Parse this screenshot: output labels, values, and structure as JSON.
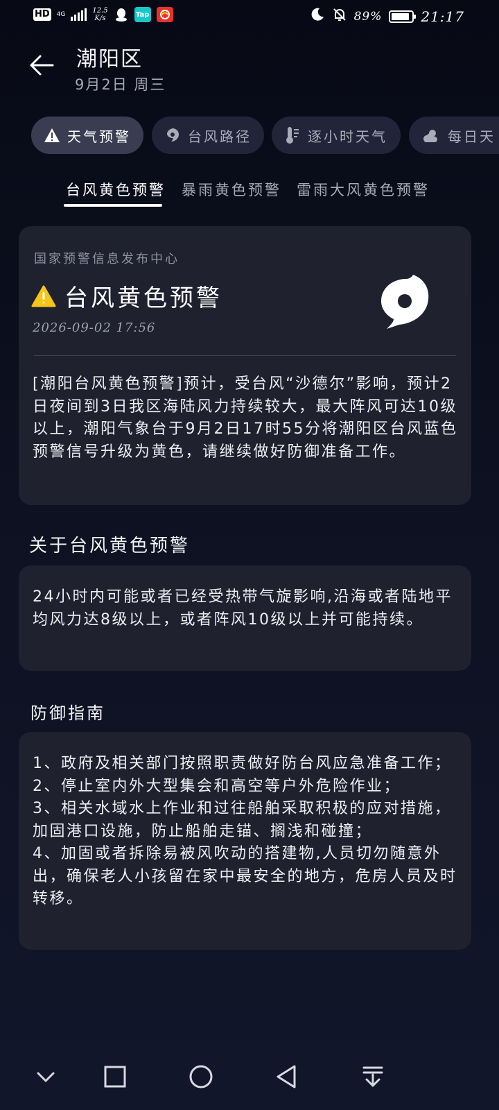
{
  "status_bar": {
    "hd": "HD",
    "network": "4G",
    "speed": "12.5",
    "speed_unit": "K/s",
    "battery": "89%",
    "battery_level": 0.89,
    "time": "21:17",
    "app_icons": [
      "qq-icon",
      "taptap-icon",
      "china-mobile-icon"
    ],
    "tap_label": "Tap",
    "status_icons": [
      "moon-icon",
      "bell-off-icon"
    ]
  },
  "header": {
    "title": "潮阳区",
    "subtitle": "9月2日 周三"
  },
  "chips": [
    {
      "label": "天气预警",
      "icon": "warning-icon",
      "active": true
    },
    {
      "label": "台风路径",
      "icon": "typhoon-icon",
      "active": false
    },
    {
      "label": "逐小时天气",
      "icon": "thermometer-icon",
      "active": false
    },
    {
      "label": "每日天",
      "icon": "partly-cloudy-icon",
      "active": false
    }
  ],
  "tabs": [
    {
      "label": "台风黄色预警",
      "active": true
    },
    {
      "label": "暴雨黄色预警",
      "active": false
    },
    {
      "label": "雷雨大风黄色预警",
      "active": false
    }
  ],
  "alert": {
    "source": "国家预警信息发布中心",
    "title": "台风黄色预警",
    "time": "2026-09-02 17:56",
    "level_color": "#f5c518",
    "body": "[潮阳台风黄色预警]预计，受台风“沙德尔”影响，预计2日夜间到3日我区海陆风力持续较大，最大阵风可达10级以上，潮阳气象台于9月2日17时55分将潮阳区台风蓝色预警信号升级为黄色，请继续做好防御准备工作。"
  },
  "about": {
    "title": "关于台风黄色预警",
    "body": "24小时内可能或者已经受热带气旋影响,沿海或者陆地平均风力达8级以上，或者阵风10级以上并可能持续。"
  },
  "guide": {
    "title": "防御指南",
    "body": "1、政府及相关部门按照职责做好防台风应急准备工作；\n2、停止室内外大型集会和高空等户外危险作业；\n3、相关水域水上作业和过往船舶采取积极的应对措施，加固港口设施，防止船舶走锚、搁浅和碰撞；\n4、加固或者拆除易被风吹动的搭建物,人员切勿随意外出，确保老人小孩留在家中最安全的地方，危房人员及时转移。"
  },
  "nav": [
    "chevron-down-icon",
    "recents-square-icon",
    "home-circle-icon",
    "back-triangle-icon",
    "notification-pull-icon"
  ]
}
